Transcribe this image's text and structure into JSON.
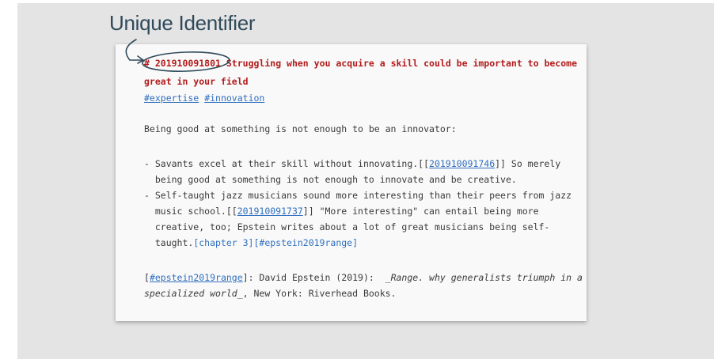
{
  "annotation": {
    "title": "Unique Identifier"
  },
  "note": {
    "heading_hash": "# ",
    "heading_id": "201910091801",
    "heading_line1_rest": " Struggling when you acquire a skill could be important to become",
    "heading_line2": "great in your field",
    "tags": [
      "#expertise",
      "#innovation"
    ],
    "intro": "Being good at something is not enough to be an innovator:",
    "bullet1": {
      "line1_prefix": "- Savants excel at their skill without innovating.[[",
      "line1_link": "201910091746",
      "line1_suffix": "]] So merely",
      "line2": "  being good at something is not enough to innovate and be creative."
    },
    "bullet2": {
      "line1": "- Self-taught jazz musicians sound more interesting than their peers from jazz",
      "line2_prefix": "  music school.[[",
      "line2_link": "201910091737",
      "line2_suffix": "]] \"More interesting\" can entail being more",
      "line3": "  creative, too; Epstein writes about a lot of great musicians being self-",
      "line4_prefix": "  taught.",
      "line4_link": "[chapter 3][#epstein2019range]"
    },
    "reference": {
      "open_bracket": "[",
      "key": "#epstein2019range",
      "mid": "]: David Epstein (2019):  ",
      "title_part1": "_Range. why generalists triumph in a",
      "title_part2": "specialized world_",
      "tail": ", New York: Riverhead Books."
    }
  },
  "colors": {
    "heading": "#b31b1b",
    "link": "#2f6fbf",
    "annotation": "#2f4a5a"
  }
}
